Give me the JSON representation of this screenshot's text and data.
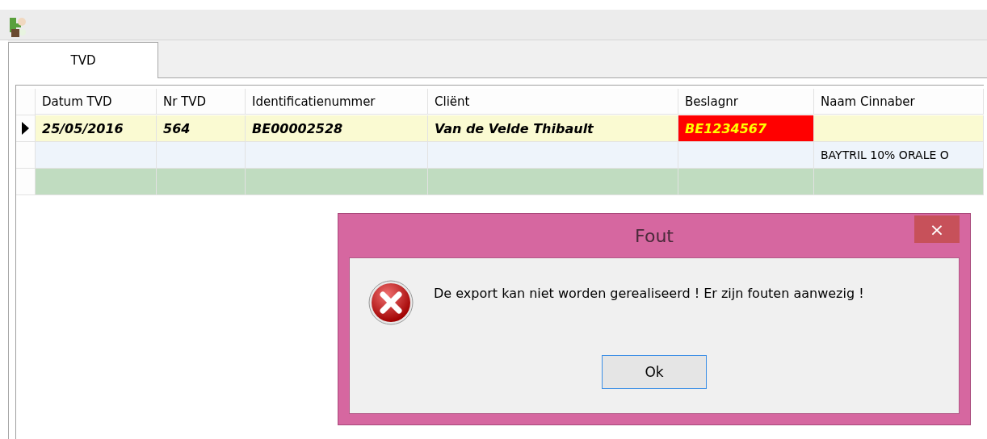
{
  "tabs": [
    {
      "label": "TVD",
      "selected": true
    }
  ],
  "grid": {
    "columns": [
      "Datum TVD",
      "Nr TVD",
      "Identificatienummer",
      "Cliënt",
      "Beslagnr",
      "Naam Cinnaber"
    ],
    "rows": [
      {
        "kind": "record",
        "current": true,
        "cells": [
          {
            "text": "25/05/2016"
          },
          {
            "text": "564"
          },
          {
            "text": "BE00002528"
          },
          {
            "text": "Van de Velde Thibault"
          },
          {
            "text": "BE1234567",
            "error": true
          },
          {
            "text": ""
          }
        ]
      },
      {
        "kind": "detail",
        "current": false,
        "cells": [
          {
            "text": ""
          },
          {
            "text": ""
          },
          {
            "text": ""
          },
          {
            "text": ""
          },
          {
            "text": ""
          },
          {
            "text": "BAYTRIL  10% ORALE O"
          }
        ]
      },
      {
        "kind": "new",
        "current": false,
        "cells": [
          {
            "text": ""
          },
          {
            "text": ""
          },
          {
            "text": ""
          },
          {
            "text": ""
          },
          {
            "text": ""
          },
          {
            "text": ""
          }
        ]
      }
    ]
  },
  "dialog": {
    "title": "Fout",
    "close": "×",
    "message": "De export kan niet worden gerealiseerd ! Er zijn fouten aanwezig !",
    "button": "Ok"
  }
}
